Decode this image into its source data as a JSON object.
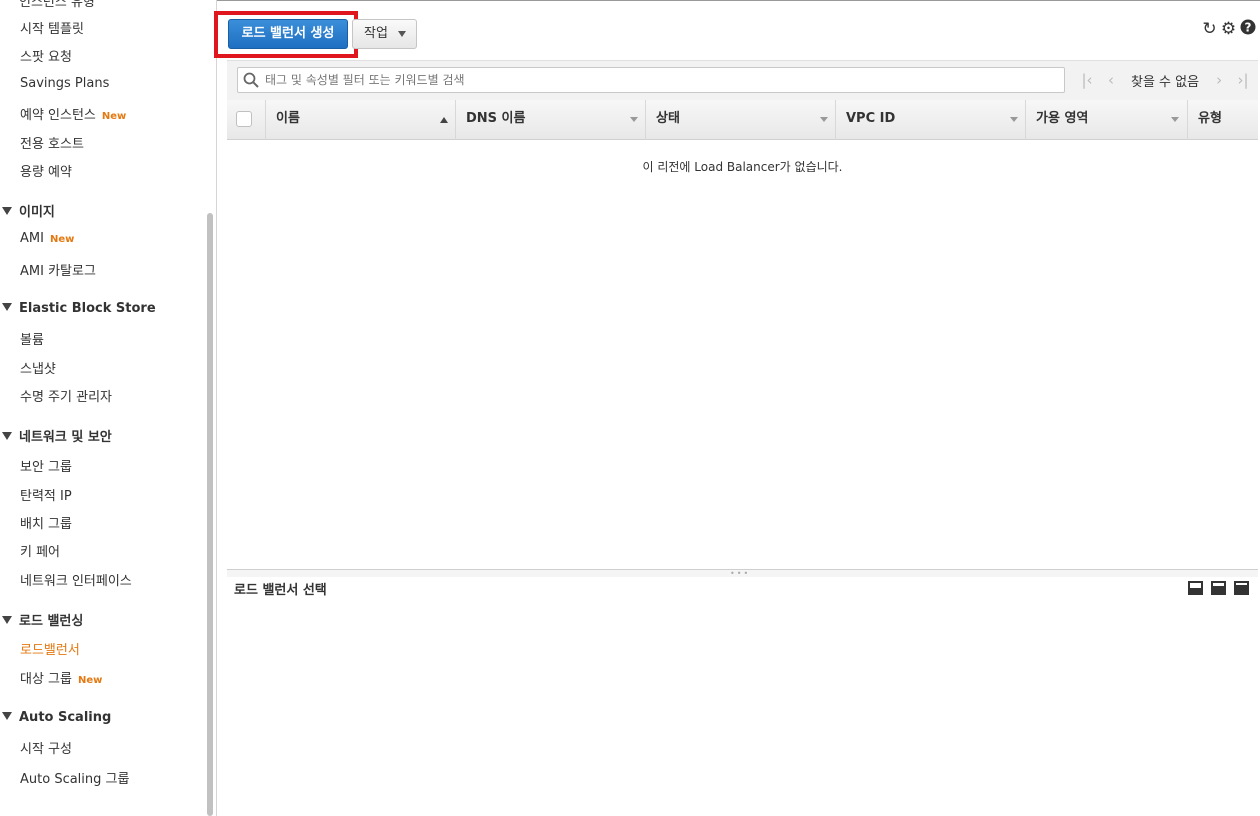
{
  "sidebar": {
    "cut_item": "인스턴스 유형",
    "items_top": [
      {
        "label": "시작 템플릿"
      },
      {
        "label": "스팟 요청"
      },
      {
        "label": "Savings Plans"
      },
      {
        "label": "예약 인스턴스",
        "badge": "New"
      },
      {
        "label": "전용 호스트"
      },
      {
        "label": "용량 예약"
      }
    ],
    "groups": [
      {
        "title": "이미지",
        "items": [
          {
            "label": "AMI",
            "badge": "New"
          },
          {
            "label": "AMI 카탈로그"
          }
        ]
      },
      {
        "title": "Elastic Block Store",
        "items": [
          {
            "label": "볼륨"
          },
          {
            "label": "스냅샷"
          },
          {
            "label": "수명 주기 관리자"
          }
        ]
      },
      {
        "title": "네트워크 및 보안",
        "items": [
          {
            "label": "보안 그룹"
          },
          {
            "label": "탄력적 IP"
          },
          {
            "label": "배치 그룹"
          },
          {
            "label": "키 페어"
          },
          {
            "label": "네트워크 인터페이스"
          }
        ]
      },
      {
        "title": "로드 밸런싱",
        "items": [
          {
            "label": "로드밸런서",
            "active": true
          },
          {
            "label": "대상 그룹",
            "badge": "New"
          }
        ]
      },
      {
        "title": "Auto Scaling",
        "items": [
          {
            "label": "시작 구성"
          },
          {
            "label": "Auto Scaling 그룹"
          }
        ]
      }
    ]
  },
  "toolbar": {
    "create_label": "로드 밸런서 생성",
    "action_label": "작업",
    "refresh_icon": "refresh-icon",
    "settings_icon": "gear-icon",
    "help_icon": "help-icon"
  },
  "filter": {
    "placeholder": "태그 및 속성별 필터 또는 키워드별 검색",
    "pager_text": "찾을 수 없음"
  },
  "table": {
    "columns": [
      "이름",
      "DNS 이름",
      "상태",
      "VPC ID",
      "가용 영역",
      "유형"
    ],
    "empty_message": "이 리전에 Load Balancer가 없습니다."
  },
  "detail_panel": {
    "title": "로드 밸런서 선택"
  },
  "colors": {
    "primary_button": "#1f6fc2",
    "highlight_box": "#e0161e",
    "active_nav": "#e47911"
  }
}
